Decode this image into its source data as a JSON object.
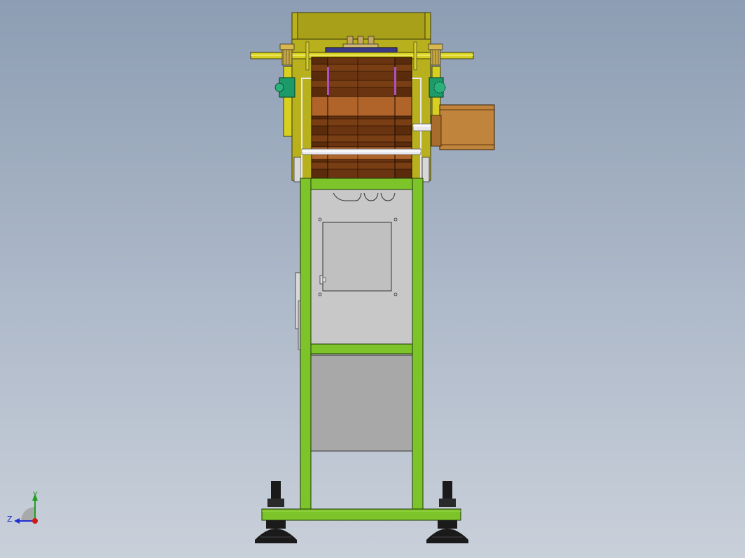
{
  "view": {
    "name": "cad-model-viewport",
    "background_top": "#8d9db3",
    "background_bottom": "#c9d0da"
  },
  "triad": {
    "y_label": "Y",
    "z_label": "Z",
    "y_color": "#1ea01e",
    "z_color": "#2030d0",
    "origin_color": "#d01818"
  },
  "colors": {
    "frame_green": "#7cc42a",
    "yellow_bracket": "#c8c020",
    "olive_housing": "#b8b01c",
    "brown_dark": "#5a2c0c",
    "brown_mid": "#8a4a1e",
    "brown_light": "#b0642a",
    "tan_motor": "#c0843c",
    "panel_gray": "#c8c8c8",
    "panel_gray_dark": "#a8a8a8",
    "teal_block": "#1c9a6a",
    "navy_plate": "#3a3a8c",
    "foot_black": "#1a1a1a"
  }
}
